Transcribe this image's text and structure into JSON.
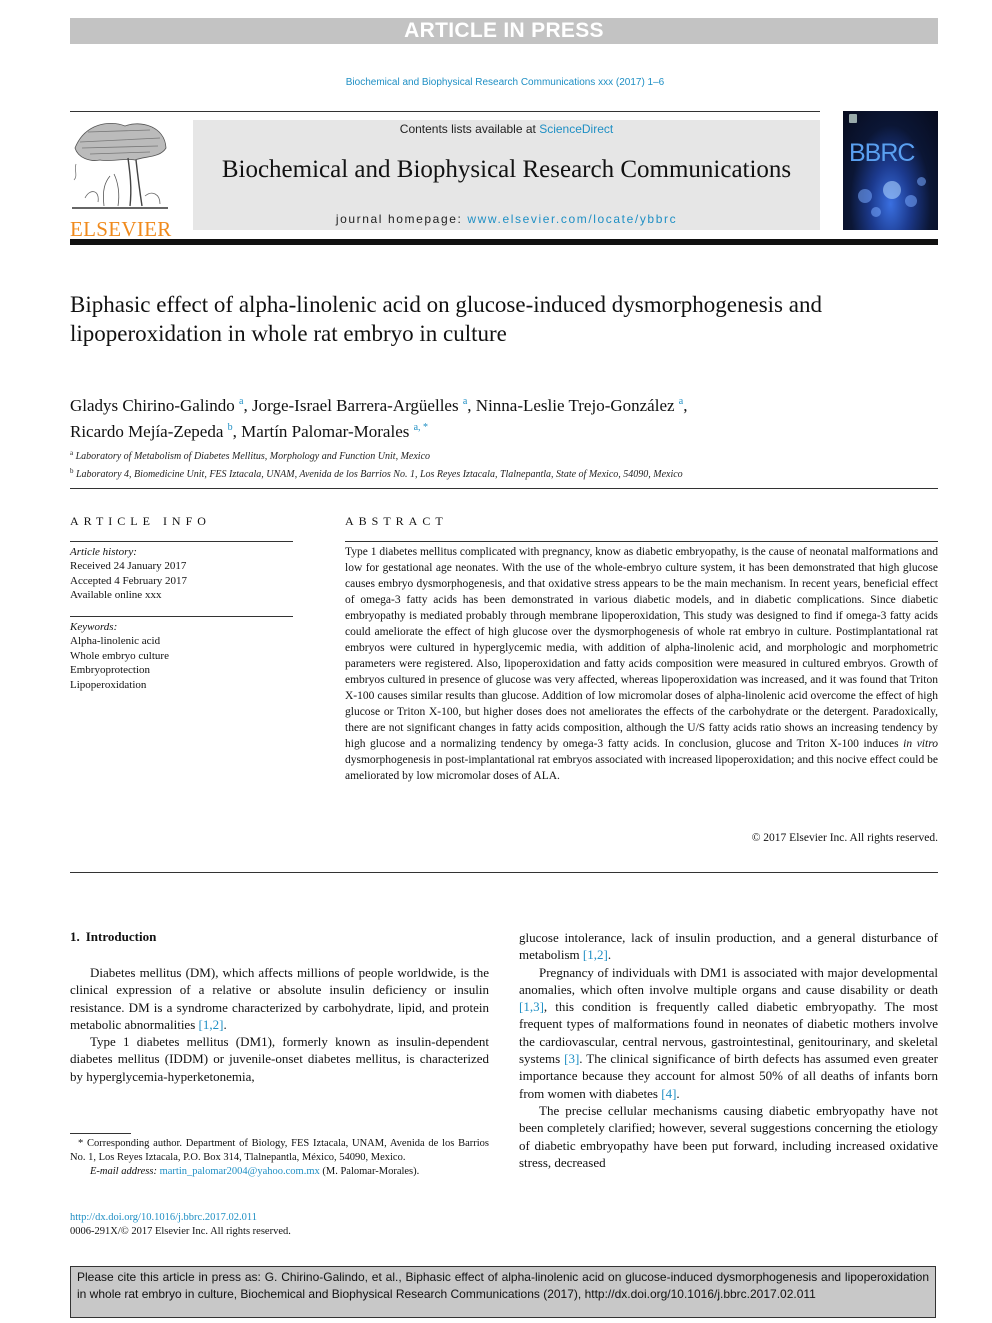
{
  "banner": {
    "article_in_press": "ARTICLE IN PRESS"
  },
  "journal_ref": "Biochemical and Biophysical Research Communications xxx (2017) 1–6",
  "masthead": {
    "publisher": "ELSEVIER",
    "contents_prefix": "Contents lists available at ",
    "contents_link": "ScienceDirect",
    "journal_title": "Biochemical and Biophysical Research Communications",
    "homepage_prefix": "journal homepage: ",
    "homepage_link": "www.elsevier.com/locate/ybbrc",
    "cover_title": "BBRC"
  },
  "article": {
    "title": "Biphasic effect of alpha-linolenic acid on glucose-induced dysmorphogenesis and lipoperoxidation in whole rat embryo in culture",
    "authors": [
      {
        "name": "Gladys Chirino-Galindo",
        "aff": "a",
        "sep": ", "
      },
      {
        "name": "Jorge-Israel Barrera-Argüelles",
        "aff": "a",
        "sep": ", "
      },
      {
        "name": "Ninna-Leslie Trejo-González",
        "aff": "a",
        "sep": ", "
      },
      {
        "name": "Ricardo Mejía-Zepeda",
        "aff": "b",
        "sep": ", "
      },
      {
        "name": "Martín Palomar-Morales",
        "aff": "a, *",
        "sep": ""
      }
    ],
    "affiliations": [
      {
        "mark": "a",
        "text": "Laboratory of Metabolism of Diabetes Mellitus, Morphology and Function Unit, Mexico"
      },
      {
        "mark": "b",
        "text": "Laboratory 4, Biomedicine Unit, FES Iztacala, UNAM, Avenida de los Barrios No. 1, Los Reyes Iztacala, Tlalnepantla, State of Mexico, 54090, Mexico"
      }
    ]
  },
  "article_info": {
    "heading": "ARTICLE INFO",
    "history_label": "Article history:",
    "history": [
      "Received 24 January 2017",
      "Accepted 4 February 2017",
      "Available online xxx"
    ],
    "keywords_label": "Keywords:",
    "keywords": [
      "Alpha-linolenic acid",
      "Whole embryo culture",
      "Embryoprotection",
      "Lipoperoxidation"
    ]
  },
  "abstract": {
    "heading": "ABSTRACT",
    "text_before_italic": "Type 1 diabetes mellitus complicated with pregnancy, know as diabetic embryopathy, is the cause of neonatal malformations and low for gestational age neonates. With the use of the whole-embryo culture system, it has been demonstrated that high glucose causes embryo dysmorphogenesis, and that oxidative stress appears to be the main mechanism. In recent years, beneficial effect of omega-3 fatty acids has been demonstrated in various diabetic models, and in diabetic complications. Since diabetic embryopathy is mediated probably through membrane lipoperoxidation, This study was designed to find if omega-3 fatty acids could ameliorate the effect of high glucose over the dysmorphogenesis of whole rat embryo in culture. Postimplantational rat embryos were cultured in hyperglycemic media, with addition of alpha-linolenic acid, and morphologic and morphometric parameters were registered. Also, lipoperoxidation and fatty acids composition were measured in cultured embryos. Growth of embryos cultured in presence of glucose was very affected, whereas lipoperoxidation was increased, and it was found that Triton X-100 causes similar results than glucose. Addition of low micromolar doses of alpha-linolenic acid overcome the effect of high glucose or Triton X-100, but higher doses does not ameliorates the effects of the carbohydrate or the detergent. Paradoxically, there are not significant changes in fatty acids composition, although the U/S fatty acids ratio shows an increasing tendency by high glucose and a normalizing tendency by omega-3 fatty acids. In conclusion, glucose and Triton X-100 induces ",
    "italic": "in vitro",
    "text_after_italic": " dysmorphogenesis in post-implantational rat embryos associated with increased lipoperoxidation; and this nocive effect could be ameliorated by low micromolar doses of ALA.",
    "copyright": "© 2017 Elsevier Inc. All rights reserved."
  },
  "introduction": {
    "heading_num": "1.",
    "heading": "Introduction",
    "left_p1_a": "Diabetes mellitus (DM), which affects millions of people worldwide, is the clinical expression of a relative or absolute insulin deficiency or insulin resistance. DM is a syndrome characterized by carbohydrate, lipid, and protein metabolic abnormalities ",
    "left_p1_ref": "[1,2]",
    "left_p1_b": ".",
    "left_p2": "Type 1 diabetes mellitus (DM1), formerly known as insulin-dependent diabetes mellitus (IDDM) or juvenile-onset diabetes mellitus, is characterized by hyperglycemia-hyperketonemia,",
    "right_p1_a": "glucose intolerance, lack of insulin production, and a general disturbance of metabolism ",
    "right_p1_ref": "[1,2]",
    "right_p1_b": ".",
    "right_p2_a": "Pregnancy of individuals with DM1 is associated with major developmental anomalies, which often involve multiple organs and cause disability or death ",
    "right_p2_ref1": "[1,3]",
    "right_p2_b": ", this condition is frequently called diabetic embryopathy. The most frequent types of malformations found in neonates of diabetic mothers involve the cardiovascular, central nervous, gastrointestinal, genitourinary, and skeletal systems ",
    "right_p2_ref2": "[3]",
    "right_p2_c": ". The clinical significance of birth defects has assumed even greater importance because they account for almost 50% of all deaths of infants born from women with diabetes ",
    "right_p2_ref3": "[4]",
    "right_p2_d": ".",
    "right_p3": "The precise cellular mechanisms causing diabetic embryopathy have not been completely clarified; however, several suggestions concerning the etiology of diabetic embryopathy have been put forward, including increased oxidative stress, decreased"
  },
  "footnote": {
    "corresponding": "* Corresponding author. Department of Biology, FES Iztacala, UNAM, Avenida de los Barrios No. 1, Los Reyes Iztacala, P.O. Box 314, Tlalnepantla, México, 54090, Mexico.",
    "email_label": "E-mail address:",
    "email": "martin_palomar2004@yahoo.com.mx",
    "email_owner": " (M. Palomar-Morales)."
  },
  "doi": "http://dx.doi.org/10.1016/j.bbrc.2017.02.011",
  "issn": "0006-291X/© 2017 Elsevier Inc. All rights reserved.",
  "cite_box": "Please cite this article in press as: G. Chirino-Galindo, et al., Biphasic effect of alpha-linolenic acid on glucose-induced dysmorphogenesis and lipoperoxidation in whole rat embryo in culture, Biochemical and Biophysical Research Communications (2017), http://dx.doi.org/10.1016/j.bbrc.2017.02.011"
}
